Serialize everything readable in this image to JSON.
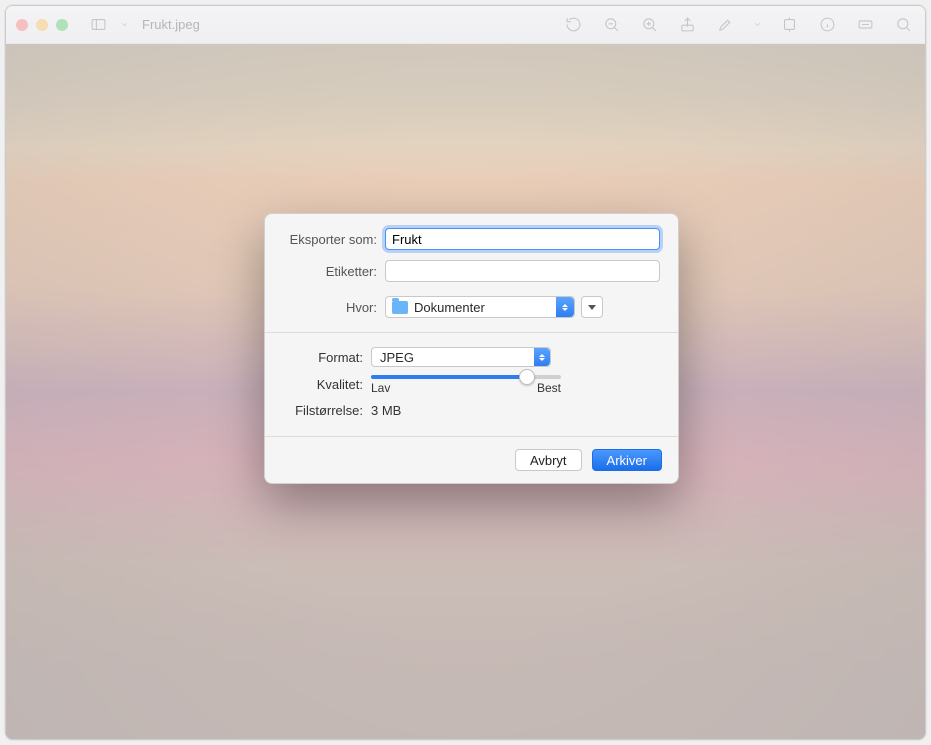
{
  "window": {
    "title": "Frukt.jpeg"
  },
  "dialog": {
    "export_as_label": "Eksporter som:",
    "export_as_value": "Frukt",
    "tags_label": "Etiketter:",
    "tags_value": "",
    "where_label": "Hvor:",
    "where_value": "Dokumenter",
    "format_label": "Format:",
    "format_value": "JPEG",
    "quality_label": "Kvalitet:",
    "quality_low": "Lav",
    "quality_high": "Best",
    "quality_percent": 82,
    "filesize_label": "Filstørrelse:",
    "filesize_value": "3 MB",
    "cancel": "Avbryt",
    "save": "Arkiver"
  }
}
